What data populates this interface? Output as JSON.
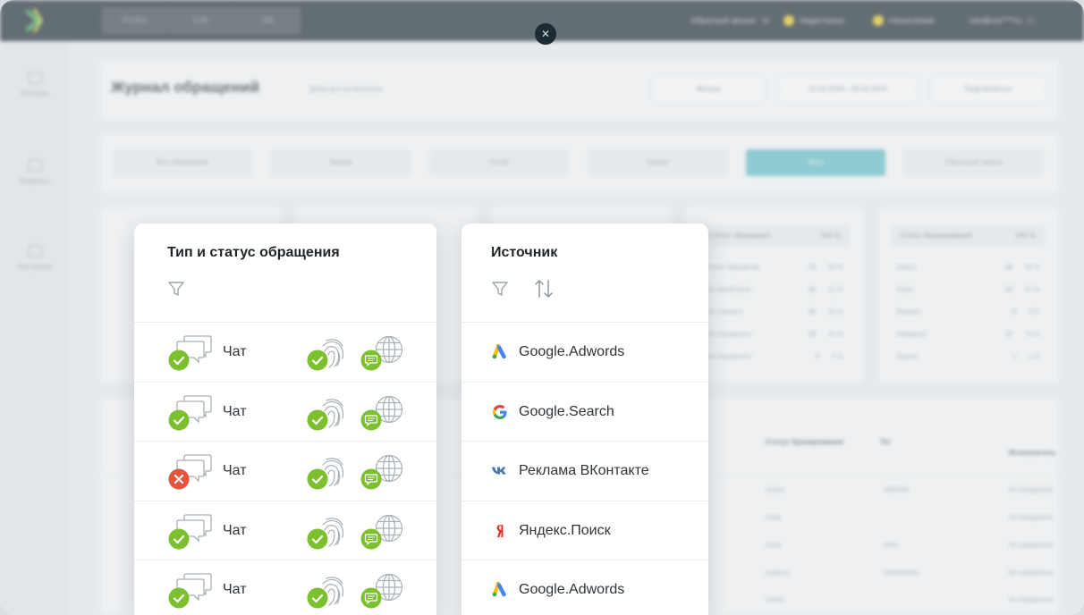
{
  "header": {
    "nav": [
      "Отчёты",
      "Счёт",
      "Info"
    ],
    "callback_label": "Обратный звонок",
    "balance_1": "Недоступно",
    "balance_2": "Начисление",
    "email": "info@mo****ru"
  },
  "sidebar": {
    "items": [
      {
        "label": "История"
      },
      {
        "label": "Виджеты"
      },
      {
        "label": "Настройки"
      }
    ]
  },
  "journal": {
    "title": "Журнал обращений",
    "hint": "Демо-доступ включен",
    "actions": [
      "Фильтр",
      "01.02.2024 - 29.02.2024",
      "Подключиться"
    ],
    "tabs": [
      {
        "label": "Все обращения",
        "active": false
      },
      {
        "label": "Звонки",
        "active": false
      },
      {
        "label": "Email",
        "active": false
      },
      {
        "label": "Заявки",
        "active": false
      },
      {
        "label": "Чаты",
        "active": true
      },
      {
        "label": "Обратный звонок",
        "active": false
      }
    ]
  },
  "stats": {
    "left_header": "Статус обращения",
    "left_header_value": "100 %",
    "left_rows": [
      {
        "label": "Новое обращение",
        "count": "75",
        "pct": "38 %"
      },
      {
        "label": "Не обработано",
        "count": "41",
        "pct": "21 %"
      },
      {
        "label": "Не отвечено",
        "count": "46",
        "pct": "23 %"
      },
      {
        "label": "Не определено",
        "count": "29",
        "pct": "15 %"
      },
      {
        "label": "Не определено",
        "count": "5",
        "pct": "3 %"
      }
    ],
    "right_header": "Статус бронирования",
    "right_header_value": "100 %",
    "right_rows": [
      {
        "label": "Запись",
        "count": "48",
        "pct": "50 %"
      },
      {
        "label": "Отказ",
        "count": "26",
        "pct": "27 %"
      },
      {
        "label": "Перенос",
        "count": "9",
        "pct": "9 %"
      },
      {
        "label": "Ожидание",
        "count": "12",
        "pct": "13 %"
      },
      {
        "label": "Прочее",
        "count": "1",
        "pct": "1 %"
      }
    ]
  },
  "table": {
    "headers": [
      "Статус бронирования",
      "Тег",
      "Исполнитель"
    ],
    "rows": [
      {
        "status": "запись",
        "tag": "#######",
        "owner": "Не определено"
      },
      {
        "status": "отказ",
        "tag": "",
        "owner": "Не определено"
      },
      {
        "status": "отказ",
        "tag": "####",
        "owner": "Не определено"
      },
      {
        "status": "перенос",
        "tag": "##########",
        "owner": "Не определено"
      },
      {
        "status": "запись",
        "tag": "",
        "owner": "Не определено"
      }
    ]
  },
  "type_panel": {
    "title": "Тип и статус обращения",
    "rows": [
      {
        "label": "Чат",
        "status": "success"
      },
      {
        "label": "Чат",
        "status": "success"
      },
      {
        "label": "Чат",
        "status": "error"
      },
      {
        "label": "Чат",
        "status": "success"
      },
      {
        "label": "Чат",
        "status": "success"
      }
    ]
  },
  "source_panel": {
    "title": "Источник",
    "rows": [
      {
        "label": "Google.Adwords",
        "icon": "google-ads-icon"
      },
      {
        "label": "Google.Search",
        "icon": "google-icon"
      },
      {
        "label": "Реклама ВКонтакте",
        "icon": "vk-icon"
      },
      {
        "label": "Яндекс.Поиск",
        "icon": "yandex-icon"
      },
      {
        "label": "Google.Adwords",
        "icon": "google-ads-icon"
      }
    ]
  },
  "colors": {
    "success": "#7cbf2f",
    "error": "#e4553b",
    "accent": "#5fb9c3",
    "dark": "#1d2b33"
  }
}
